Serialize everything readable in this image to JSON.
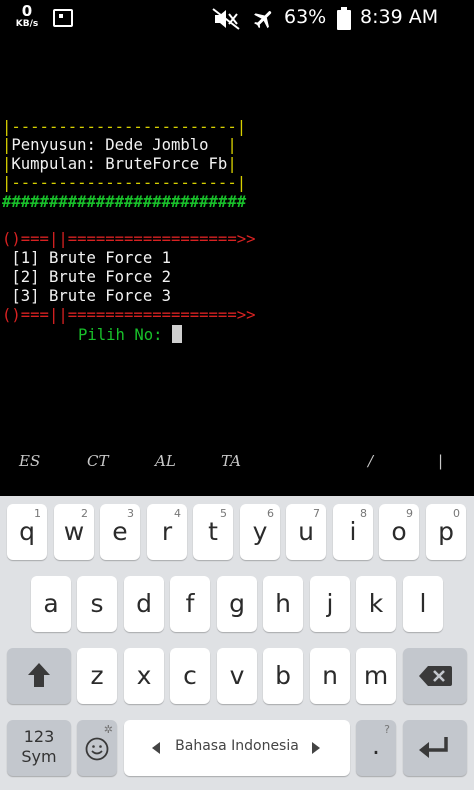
{
  "status_bar": {
    "net_speed": "0",
    "net_speed_unit": "KB/s",
    "battery_percent": "63%",
    "time": "8:39 AM",
    "icons": [
      "screen-icon",
      "mute-icon",
      "airplane-icon",
      "battery-icon"
    ]
  },
  "terminal": {
    "border_top": "|------------------------|",
    "author_line": "|Penyusun: Dede Jomblo  |",
    "collection_line": "|Kumpulan: BruteForce Fb|",
    "border_bottom": "|------------------------|",
    "hash_line": "##########################",
    "menu_separator_top": "()===||==================>>",
    "options": [
      " [1] Brute Force 1",
      " [2] Brute Force 2",
      " [3] Brute Force 3"
    ],
    "menu_separator_bottom": "()===||==================>>",
    "prompt": "Pilih No: "
  },
  "extra_keys": [
    "ES",
    "CT",
    "AL",
    "TA",
    "/",
    "|"
  ],
  "keyboard": {
    "row1": [
      {
        "key": "q",
        "hint": "1"
      },
      {
        "key": "w",
        "hint": "2"
      },
      {
        "key": "e",
        "hint": "3"
      },
      {
        "key": "r",
        "hint": "4"
      },
      {
        "key": "t",
        "hint": "5"
      },
      {
        "key": "y",
        "hint": "6"
      },
      {
        "key": "u",
        "hint": "7"
      },
      {
        "key": "i",
        "hint": "8"
      },
      {
        "key": "o",
        "hint": "9"
      },
      {
        "key": "p",
        "hint": "0"
      }
    ],
    "row2": [
      "a",
      "s",
      "d",
      "f",
      "g",
      "h",
      "j",
      "k",
      "l"
    ],
    "row3": [
      "z",
      "x",
      "c",
      "v",
      "b",
      "n",
      "m"
    ],
    "symbols_label_1": "123",
    "symbols_label_2": "Sym",
    "space_label": "Bahasa Indonesia",
    "period_key": ".",
    "period_hint": "?",
    "emoji_hint": "✲"
  },
  "colors": {
    "terminal_bg": "#000000",
    "border_yellow": "#d7d000",
    "text_green": "#18c02a",
    "text_red": "#d82222",
    "keyboard_bg": "#dfe1e4"
  }
}
